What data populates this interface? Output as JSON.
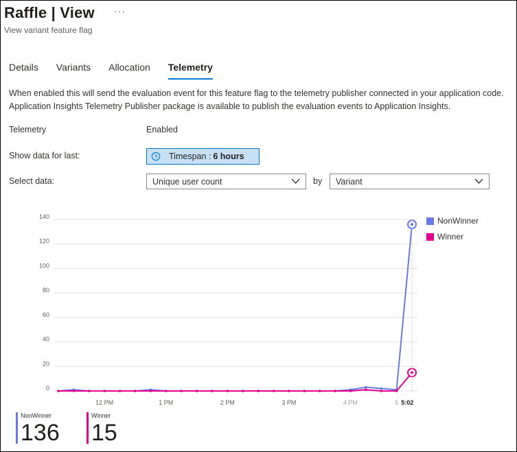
{
  "header": {
    "title": "Raffle | View",
    "ellipsis": "···",
    "subtitle": "View variant feature flag"
  },
  "tabs": [
    {
      "label": "Details",
      "active": false
    },
    {
      "label": "Variants",
      "active": false
    },
    {
      "label": "Allocation",
      "active": false
    },
    {
      "label": "Telemetry",
      "active": true
    }
  ],
  "telemetry": {
    "description": "When enabled this will send the evaluation event for this feature flag to the telemetry publisher connected in your application code. Application Insights Telemetry Publisher package is available to publish the evaluation events to Application Insights.",
    "telemetry_label": "Telemetry",
    "telemetry_value": "Enabled",
    "show_data_label": "Show data for last:",
    "timespan_prefix": "Timespan :",
    "timespan_value": "6 hours",
    "timespan_icon": "clock-icon",
    "select_data_label": "Select data:",
    "metric_select": "Unique user count",
    "by_label": "by",
    "group_select": "Variant"
  },
  "colors": {
    "accent": "#0078d4",
    "nonwinner": "#6879e6",
    "winner": "#e3008c",
    "grid": "#e1dfdd"
  },
  "chart_data": {
    "type": "line",
    "yticks": [
      "140",
      "120",
      "100",
      "80",
      "60",
      "40",
      "20",
      "0"
    ],
    "ylim": [
      0,
      140
    ],
    "xticks": [
      {
        "label": "12 PM",
        "i": 3
      },
      {
        "label": "1 PM",
        "i": 7
      },
      {
        "label": "2 PM",
        "i": 11
      },
      {
        "label": "3 PM",
        "i": 15
      },
      {
        "label": "4 PM",
        "i": 19
      },
      {
        "label": "5",
        "i": 22
      },
      {
        "label": "5:02",
        "i": 22.7
      }
    ],
    "x": [
      0,
      1,
      2,
      3,
      4,
      5,
      6,
      7,
      8,
      9,
      10,
      11,
      12,
      13,
      14,
      15,
      16,
      17,
      18,
      19,
      20,
      21,
      22,
      23
    ],
    "series": [
      {
        "name": "NonWinner",
        "values": [
          0,
          1,
          0,
          0,
          0,
          0,
          1,
          0,
          0,
          0,
          0,
          0,
          0,
          0,
          0,
          0,
          0,
          0,
          0,
          1,
          3,
          2,
          1,
          136
        ]
      },
      {
        "name": "Winner",
        "values": [
          0,
          0,
          0,
          0,
          0,
          0,
          0,
          0,
          0,
          0,
          0,
          0,
          0,
          0,
          0,
          0,
          0,
          0,
          0,
          0,
          1,
          0,
          0,
          15
        ]
      }
    ],
    "legend": "right",
    "grid": true
  },
  "stats": [
    {
      "name": "NonWinner",
      "value": "136"
    },
    {
      "name": "Winner",
      "value": "15"
    }
  ]
}
